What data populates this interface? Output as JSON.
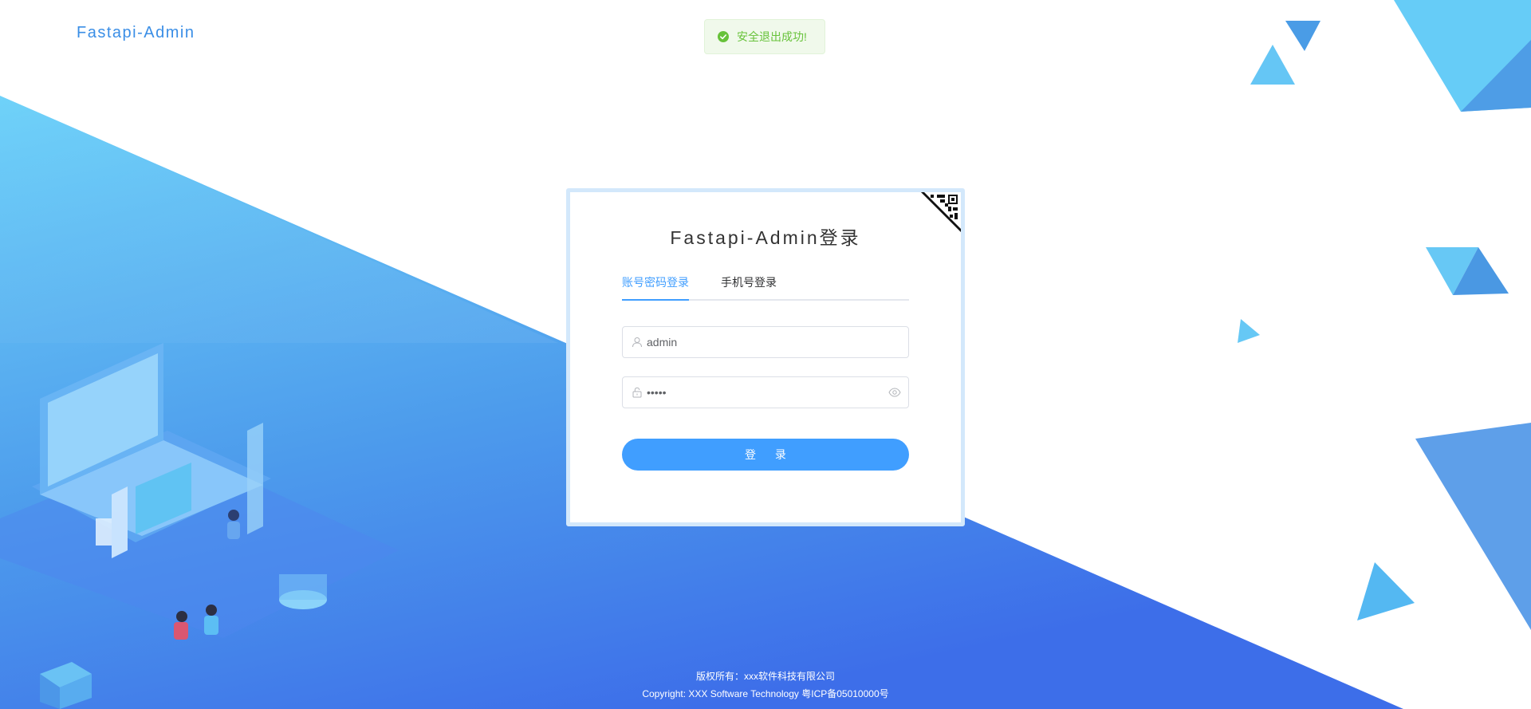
{
  "brand": {
    "name": "Fastapi-Admin"
  },
  "notification": {
    "message": "安全退出成功!",
    "icon": "success-check-icon",
    "color": "#67c23a"
  },
  "login": {
    "title": "Fastapi-Admin登录",
    "qr_toggle_icon": "qr-code-icon",
    "tabs": [
      {
        "label": "账号密码登录",
        "active": true
      },
      {
        "label": "手机号登录",
        "active": false
      }
    ],
    "username": {
      "value": "admin",
      "icon": "user-icon"
    },
    "password": {
      "value": "12345",
      "icon": "lock-icon",
      "toggle_icon": "eye-icon"
    },
    "submit_label": "登 录"
  },
  "footer": {
    "copyright_cn": "版权所有：xxx软件科技有限公司",
    "copyright_en": "Copyright: XXX Software Technology 粤ICP备05010000号"
  },
  "colors": {
    "primary": "#409eff",
    "brand": "#3a8ee6",
    "background_light": "#6dd0f8",
    "background_dark": "#3f6fe8"
  }
}
